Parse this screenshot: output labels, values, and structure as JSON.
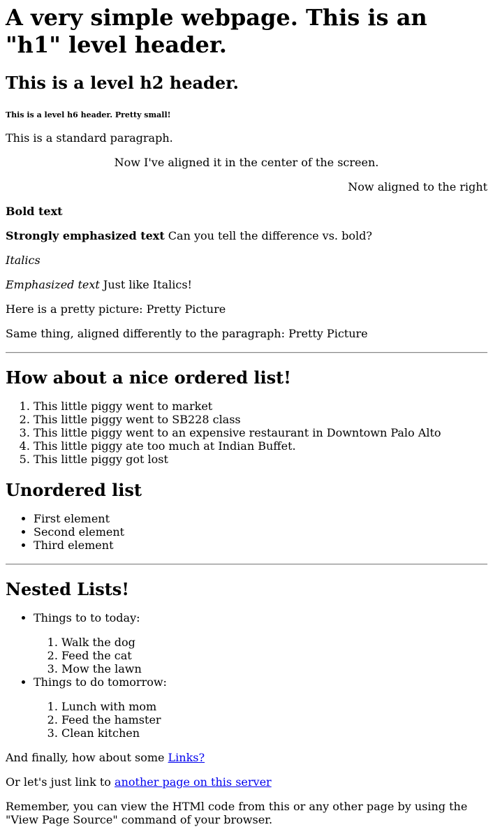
{
  "h1": "A very simple webpage. This is an \"h1\" level header.",
  "h2": "This is a level h2 header.",
  "h6": "This is a level h6 header. Pretty small!",
  "p_standard": "This is a standard paragraph.",
  "p_center": "Now I've aligned it in the center of the screen.",
  "p_right": "Now aligned to the right",
  "bold_text": "Bold text",
  "strong_text": "Strongly emphasized text",
  "strong_tail": " Can you tell the difference vs. bold?",
  "italics_text": "Italics",
  "em_text": "Emphasized text",
  "em_tail": " Just like Italics!",
  "picture_prefix": "Here is a pretty picture: ",
  "picture_alt": "Pretty Picture",
  "picture2_prefix": "Same thing, aligned differently to the paragraph: ",
  "picture2_alt": "Pretty Picture",
  "ordered_heading": "How about a nice ordered list!",
  "ordered_items": [
    "This little piggy went to market",
    "This little piggy went to SB228 class",
    "This little piggy went to an expensive restaurant in Downtown Palo Alto",
    "This little piggy ate too much at Indian Buffet.",
    "This little piggy got lost"
  ],
  "unordered_heading": "Unordered list",
  "unordered_items": [
    "First element",
    "Second element",
    "Third element"
  ],
  "nested_heading": "Nested Lists!",
  "nested": [
    {
      "label": "Things to to today:",
      "items": [
        "Walk the dog",
        "Feed the cat",
        "Mow the lawn"
      ]
    },
    {
      "label": "Things to do tomorrow:",
      "items": [
        "Lunch with mom",
        "Feed the hamster",
        "Clean kitchen"
      ]
    }
  ],
  "links_prefix": "And finally, how about some ",
  "links_link": "Links?",
  "server_prefix": "Or let's just link to ",
  "server_link": "another page on this server",
  "remember": "Remember, you can view the HTMl code from this or any other page by using the \"View Page Source\" command of your browser.",
  "colors": {
    "link": "#0000ee",
    "text": "#000000",
    "background": "#ffffff"
  }
}
